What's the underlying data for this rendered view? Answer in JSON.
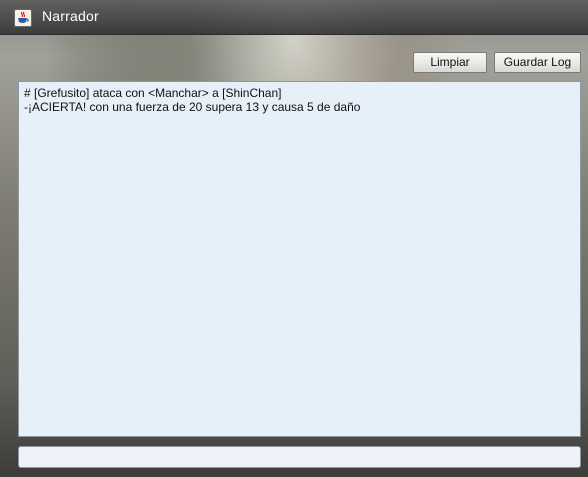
{
  "window": {
    "title": "Narrador",
    "icon": "java-cup-icon"
  },
  "toolbar": {
    "clear_label": "Limpiar",
    "save_log_label": "Guardar Log"
  },
  "log": {
    "lines": [
      "# [Grefusito] ataca con <Manchar> a [ShinChan]",
      "-¡ACIERTA! con una fuerza de 20 supera 13 y causa 5 de daño"
    ]
  },
  "command_input": {
    "value": ""
  }
}
